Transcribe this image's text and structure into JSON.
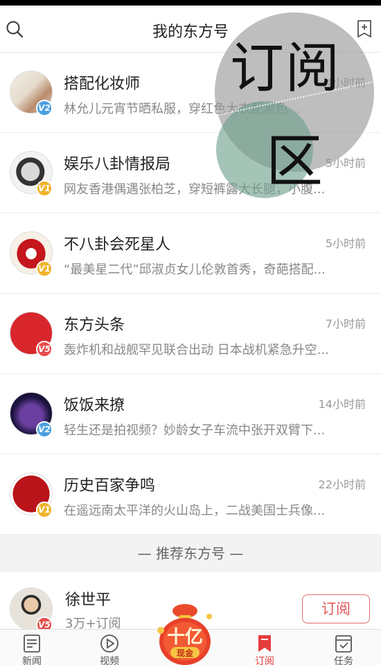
{
  "header": {
    "title": "我的东方号"
  },
  "subscriptions": [
    {
      "name": "搭配化妆师",
      "time": "4小时前",
      "desc": "林允儿元宵节晒私服，穿红色大衣配黑色...",
      "badge": "V2",
      "badge_color": "#4a9fe0"
    },
    {
      "name": "娱乐八卦情报局",
      "time": "5小时前",
      "desc": "网友香港偶遇张柏芝，穿短裤露大长腿，小腹...",
      "badge": "V1",
      "badge_color": "#f0b429"
    },
    {
      "name": "不八卦会死星人",
      "time": "5小时前",
      "desc": "“最美星二代”邱淑贞女儿伦敦首秀，奇葩搭配...",
      "badge": "V1",
      "badge_color": "#f0b429"
    },
    {
      "name": "东方头条",
      "time": "7小时前",
      "desc": "轰炸机和战舰罕见联合出动 日本战机紧急升空...",
      "badge": "V5",
      "badge_color": "#e84c4c"
    },
    {
      "name": "饭饭来撩",
      "time": "14小时前",
      "desc": "轻生还是拍视频？妙龄女子车流中张开双臂下...",
      "badge": "V2",
      "badge_color": "#4a9fe0"
    },
    {
      "name": "历史百家争鸣",
      "time": "22小时前",
      "desc": "在遥远南太平洋的火山岛上，二战美国士兵像...",
      "badge": "V1",
      "badge_color": "#f0b429"
    }
  ],
  "recommend": {
    "section_title": "— 推荐东方号 —",
    "name": "徐世平",
    "meta": "3万+订阅",
    "badge": "V5",
    "subscribe_label": "订阅"
  },
  "overlay": {
    "line1": "订阅",
    "line2": "区"
  },
  "promo": {
    "line1": "十亿",
    "line2": "现金"
  },
  "tabs": [
    {
      "label": "新闻",
      "icon": "news-icon"
    },
    {
      "label": "视频",
      "icon": "video-icon"
    },
    {
      "label": "订阅",
      "icon": "bookmark-icon",
      "active": true
    },
    {
      "label": "任务",
      "icon": "task-icon"
    }
  ],
  "colors": {
    "accent": "#e43c3c",
    "v1": "#f0b429",
    "v2": "#4a9fe0",
    "v5": "#e84c4c"
  }
}
